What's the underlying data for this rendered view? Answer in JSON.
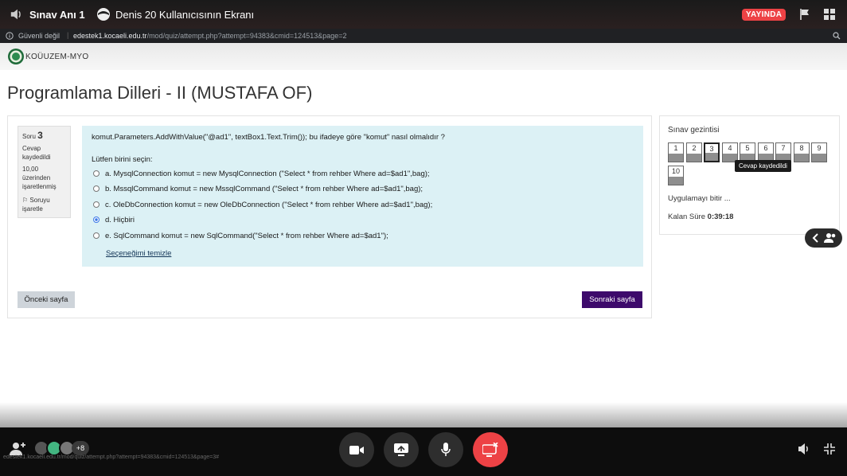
{
  "topbar": {
    "channel": "Sınav Anı 1",
    "screen_title": "Denis 20 Kullanıcısının Ekranı",
    "live_badge": "YAYINDA",
    "icons": [
      "volume-icon",
      "camera-icon",
      "flag-icon",
      "grid-icon"
    ]
  },
  "browser": {
    "insecure_label": "Güvenli değil",
    "separator": "|",
    "host": "edestek1.kocaeli.edu.tr",
    "path": "/mod/quiz/attempt.php?attempt=94383&cmid=124513&page=2"
  },
  "site": {
    "brand": "KOÜUZEM-MYO"
  },
  "page": {
    "title": "Programlama Dilleri - II (MUSTAFA OF)"
  },
  "question_info": {
    "label": "Soru",
    "number": "3",
    "state": "Cevap kaydedildi",
    "mark_line1": "10,00",
    "mark_line2": "üzerinden",
    "mark_line3": "işaretlenmiş",
    "flag_label": "Soruyu işaretle"
  },
  "question": {
    "text": "komut.Parameters.AddWithValue(\"@ad1\", textBox1.Text.Trim()); bu ifadeye göre \"komut\" nasıl olmalıdır ?",
    "prompt": "Lütfen birini seçin:",
    "options": [
      {
        "label": "a. MysqlConnection komut = new MysqlConnection (\"Select * from rehber Where ad=$ad1\",bag);",
        "selected": false
      },
      {
        "label": "b. MssqlCommand komut = new MssqlCommand (\"Select * from rehber Where ad=$ad1\",bag);",
        "selected": false
      },
      {
        "label": "c. OleDbConnection komut = new OleDbConnection (\"Select * from rehber Where ad=$ad1\",bag);",
        "selected": false
      },
      {
        "label": "d. Hiçbiri",
        "selected": true
      },
      {
        "label": "e. SqlCommand komut = new SqlCommand(\"Select * from rehber Where ad=$ad1\");",
        "selected": false
      }
    ],
    "clear_label": "Seçeneğimi temizle"
  },
  "buttons": {
    "prev": "Önceki sayfa",
    "next": "Sonraki sayfa"
  },
  "quiz_nav": {
    "title": "Sınav gezintisi",
    "questions": [
      {
        "num": "1",
        "answered": true,
        "current": false
      },
      {
        "num": "2",
        "answered": true,
        "current": false
      },
      {
        "num": "3",
        "answered": true,
        "current": true
      },
      {
        "num": "4",
        "answered": true,
        "current": false
      },
      {
        "num": "5",
        "answered": true,
        "current": false
      },
      {
        "num": "6",
        "answered": true,
        "current": false
      },
      {
        "num": "7",
        "answered": true,
        "current": false
      },
      {
        "num": "8",
        "answered": true,
        "current": false
      },
      {
        "num": "9",
        "answered": true,
        "current": false
      },
      {
        "num": "10",
        "answered": true,
        "current": false
      }
    ],
    "tooltip": "Cevap kaydedildi",
    "finish_label": "Uygulamayı bitir ...",
    "time_label": "Kalan Süre",
    "time_value": "0:39:18"
  },
  "call": {
    "extra_participants": "+8",
    "status_url": "edestek1.kocaeli.edu.tr/mod/quiz/attempt.php?attempt=94383&cmid=124513&page=3#",
    "leave_color": "#ed4245",
    "live_color": "#ed4245"
  }
}
